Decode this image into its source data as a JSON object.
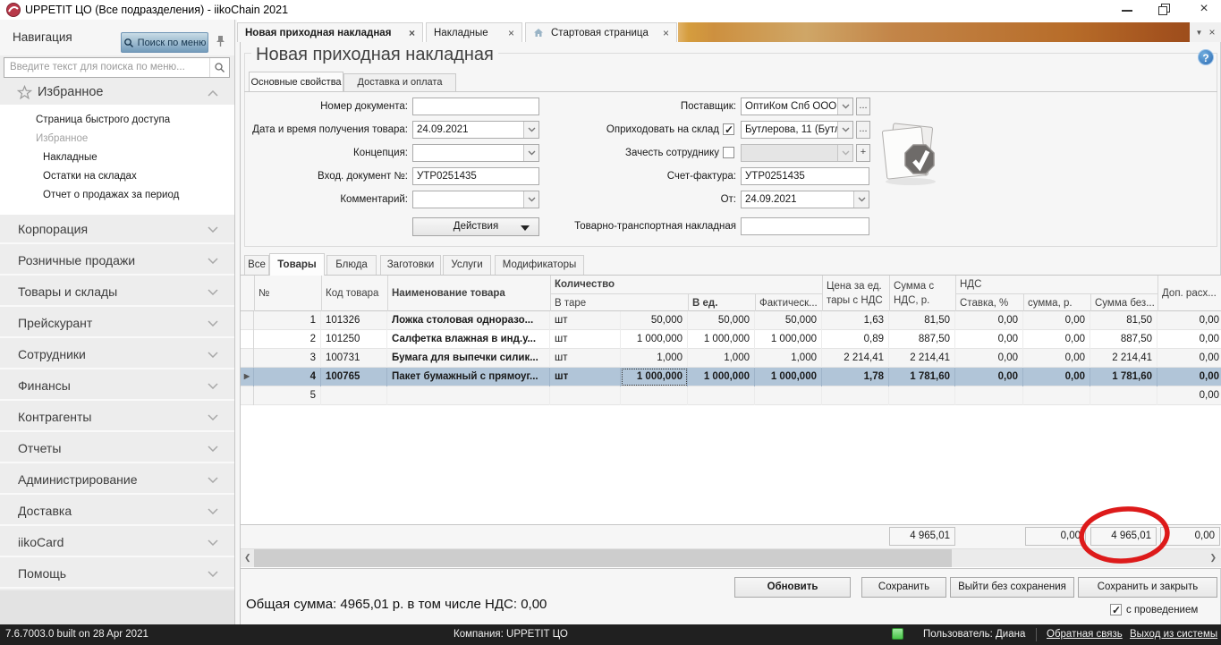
{
  "window": {
    "title": "UPPETIT ЦО (Все подразделения)  - iikoChain 2021"
  },
  "doc_tabs": [
    {
      "label": "Новая приходная накладная"
    },
    {
      "label": "Накладные"
    },
    {
      "label": "Стартовая страница"
    }
  ],
  "nav": {
    "title": "Навигация",
    "search_button": "Поиск по меню",
    "search_placeholder": "Введите текст для поиска по меню...",
    "favorites_header": "Избранное",
    "favorites": [
      "Страница быстрого доступа",
      "Избранное",
      "Накладные",
      "Остатки на складах",
      "Отчет о продажах за период"
    ],
    "sections": [
      "Корпорация",
      "Розничные продажи",
      "Товары и склады",
      "Прейскурант",
      "Сотрудники",
      "Финансы",
      "Контрагенты",
      "Отчеты",
      "Администрирование",
      "Доставка",
      "iikoCard",
      "Помощь"
    ]
  },
  "page": {
    "title": "Новая приходная накладная",
    "tab_main": "Основные свойства",
    "tab_delivery": "Доставка и оплата"
  },
  "form": {
    "doc_number_label": "Номер документа:",
    "doc_number_value": "",
    "date_label": "Дата и время получения товара:",
    "date_value": "24.09.2021",
    "concept_label": "Концепция:",
    "concept_value": "",
    "incoming_doc_label": "Вход. документ №:",
    "incoming_doc_value": "УТР0251435",
    "comment_label": "Комментарий:",
    "comment_value": "",
    "actions_button": "Действия",
    "supplier_label": "Поставщик:",
    "supplier_value": "ОптиКом Спб ООО",
    "warehouse_label": "Оприходовать на склад",
    "warehouse_value": "Бутлерова, 11 (Бутле",
    "employee_label": "Зачесть сотруднику",
    "employee_value": "",
    "invoice_label": "Счет-фактура:",
    "invoice_value": "УТР0251435",
    "from_label": "От:",
    "from_value": "24.09.2021",
    "waybill_label": "Товарно-транспортная накладная",
    "waybill_value": ""
  },
  "table": {
    "tabs": [
      "Все",
      "Товары",
      "Блюда",
      "Заготовки",
      "Услуги",
      "Модификаторы"
    ],
    "active_tab": "Товары",
    "headers": {
      "no": "№",
      "code": "Код товара",
      "name": "Наименование товара",
      "qty_group": "Количество",
      "tare": "В таре",
      "unit": "В ед.",
      "fact": "Фактическ...",
      "price": "Цена за ед. тары с НДС",
      "sum": "Сумма с НДС, р.",
      "vat_group": "НДС",
      "vat_rate": "Ставка, %",
      "vat_sum": "сумма, р.",
      "sum_novat": "Сумма без...",
      "extra": "Доп. расх..."
    },
    "rows": [
      [
        "1",
        "101326",
        "Ложка столовая одноразо...",
        "шт",
        "50,000",
        "50,000",
        "50,000",
        "1,63",
        "81,50",
        "0,00",
        "0,00",
        "81,50",
        "0,00"
      ],
      [
        "2",
        "101250",
        "Салфетка влажная в инд.у...",
        "шт",
        "1 000,000",
        "1 000,000",
        "1 000,000",
        "0,89",
        "887,50",
        "0,00",
        "0,00",
        "887,50",
        "0,00"
      ],
      [
        "3",
        "100731",
        "Бумага для выпечки силик...",
        "шт",
        "1,000",
        "1,000",
        "1,000",
        "2 214,41",
        "2 214,41",
        "0,00",
        "0,00",
        "2 214,41",
        "0,00"
      ],
      [
        "4",
        "100765",
        "Пакет бумажный с прямоуг...",
        "шт",
        "1 000,000",
        "1 000,000",
        "1 000,000",
        "1,78",
        "1 781,60",
        "0,00",
        "0,00",
        "1 781,60",
        "0,00"
      ],
      [
        "5",
        "",
        "",
        "",
        "",
        "",
        "",
        "",
        "",
        "",
        "",
        "",
        "0,00"
      ]
    ],
    "selected_row_index": 3,
    "totals": {
      "sum_with_vat": "4 965,01",
      "vat_sum": "0,00",
      "sum_no_vat": "4 965,01",
      "extra": "0,00"
    }
  },
  "footer": {
    "refresh": "Обновить",
    "save": "Сохранить",
    "exit_nosave": "Выйти без сохранения",
    "save_close": "Сохранить и закрыть",
    "total_line": "Общая сумма: 4965,01 р. в том числе НДС: 0,00",
    "post_checkbox": "с проведением"
  },
  "status": {
    "version": "7.6.7003.0 built on 28 Apr 2021",
    "company": "Компания: UPPETIT ЦО",
    "user": "Пользователь: Диана",
    "feedback": "Обратная связь",
    "logout": "Выход из системы"
  }
}
